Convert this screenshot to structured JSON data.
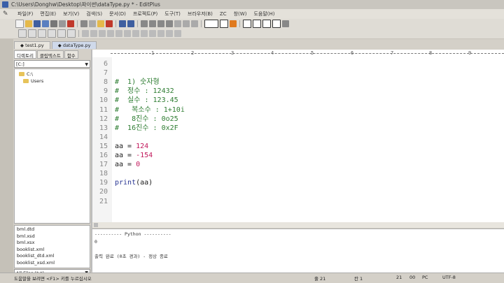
{
  "window": {
    "title": "C:\\Users\\Donghw\\Desktop\\파이썬\\dataType.py * - EditPlus"
  },
  "menu": [
    "파일(F)",
    "편집(E)",
    "보기(V)",
    "검색(S)",
    "문서(D)",
    "프로젝트(P)",
    "도구(T)",
    "브라우저(B)",
    "ZC",
    "창(W)",
    "도움말(H)"
  ],
  "left_panel": {
    "tabs": [
      "디렉토리",
      "클립텍스트",
      "함수"
    ],
    "drive": "[C:]",
    "tree": [
      "C:\\",
      "Users"
    ],
    "files": [
      "bml.dtd",
      "bml.xsd",
      "bml.xsx",
      "booklist.xml",
      "booklist_dtd.xml",
      "booklist_xsd.xml"
    ],
    "filter": "All Files (*.*)"
  },
  "doc_tabs": [
    "test1.py",
    "dataType.py"
  ],
  "ruler": [
    "1",
    "2",
    "3",
    "4",
    "5",
    "6",
    "7",
    "8",
    "9"
  ],
  "code": [
    {
      "ln": "6",
      "parts": []
    },
    {
      "ln": "7",
      "parts": []
    },
    {
      "ln": "8",
      "parts": [
        {
          "t": "#  1) 숫자형",
          "c": "comment"
        }
      ]
    },
    {
      "ln": "9",
      "parts": [
        {
          "t": "#  정수 : 12432",
          "c": "comment"
        }
      ]
    },
    {
      "ln": "10",
      "parts": [
        {
          "t": "#  실수 : 123.45",
          "c": "comment"
        }
      ]
    },
    {
      "ln": "11",
      "parts": [
        {
          "t": "#   복소수 : 1+10i",
          "c": "comment"
        }
      ]
    },
    {
      "ln": "12",
      "parts": [
        {
          "t": "#   8진수 : 0o25",
          "c": "comment"
        }
      ]
    },
    {
      "ln": "13",
      "parts": [
        {
          "t": "#  16진수 : 0x2F",
          "c": "comment"
        }
      ]
    },
    {
      "ln": "14",
      "parts": []
    },
    {
      "ln": "15",
      "parts": [
        {
          "t": "aa = ",
          "c": "normal"
        },
        {
          "t": "124",
          "c": "num"
        }
      ]
    },
    {
      "ln": "16",
      "parts": [
        {
          "t": "aa = ",
          "c": "normal"
        },
        {
          "t": "-154",
          "c": "num"
        }
      ]
    },
    {
      "ln": "17",
      "parts": [
        {
          "t": "aa = ",
          "c": "normal"
        },
        {
          "t": "0",
          "c": "num"
        }
      ]
    },
    {
      "ln": "18",
      "parts": []
    },
    {
      "ln": "19",
      "parts": [
        {
          "t": "print",
          "c": "kw"
        },
        {
          "t": "(aa)",
          "c": "normal"
        }
      ]
    },
    {
      "ln": "20",
      "parts": []
    },
    {
      "ln": "21",
      "parts": []
    }
  ],
  "output": [
    "---------- Python ----------",
    "0",
    "",
    "출력 완료 (0초 경과) - 정상 종료"
  ],
  "status": {
    "message": "도움말을 보려면 <F1> 키를 누르십시오",
    "ln": "줄 21",
    "col": "칸 1",
    "total": "21",
    "pos": "00",
    "mode": "PC",
    "encoding": "UTF-8"
  }
}
